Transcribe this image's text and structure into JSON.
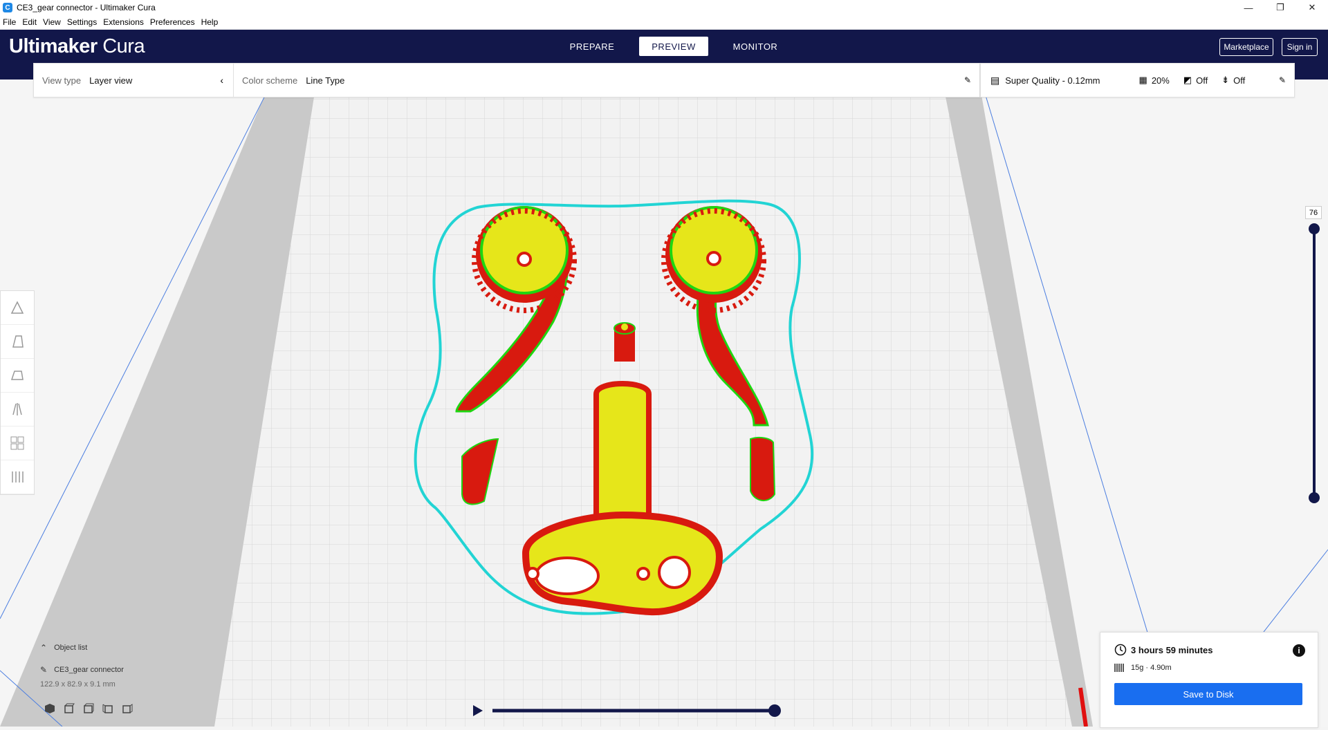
{
  "window": {
    "title": "CE3_gear connector - Ultimaker Cura",
    "minimize": "—",
    "maximize": "❐",
    "close": "✕"
  },
  "menu": [
    "File",
    "Edit",
    "View",
    "Settings",
    "Extensions",
    "Preferences",
    "Help"
  ],
  "header": {
    "logo_bold": "Ultimaker",
    "logo_light": "Cura",
    "stages": [
      "PREPARE",
      "PREVIEW",
      "MONITOR"
    ],
    "active_stage": "PREVIEW",
    "marketplace": "Marketplace",
    "signin": "Sign in"
  },
  "view_panel": {
    "view_type_label": "View type",
    "view_type_value": "Layer view",
    "color_scheme_label": "Color scheme",
    "color_scheme_value": "Line Type"
  },
  "print_settings": {
    "profile": "Super Quality - 0.12mm",
    "infill": "20%",
    "support": "Off",
    "adhesion": "Off"
  },
  "layer_slider": {
    "current_layer": "76"
  },
  "object_list": {
    "title": "Object list",
    "object_name": "CE3_gear connector",
    "dimensions": "122.9 x 82.9 x 9.1 mm"
  },
  "print_info": {
    "time": "3 hours 59 minutes",
    "material": "15g · 4.90m",
    "save_button": "Save to Disk",
    "info_icon": "i"
  },
  "colors": {
    "header": "#12174a",
    "accent": "#196ef0",
    "wall_outer": "#d81a0f",
    "wall_inner": "#1ed611",
    "infill": "#e6e61a",
    "skirt": "#22d4d4"
  }
}
